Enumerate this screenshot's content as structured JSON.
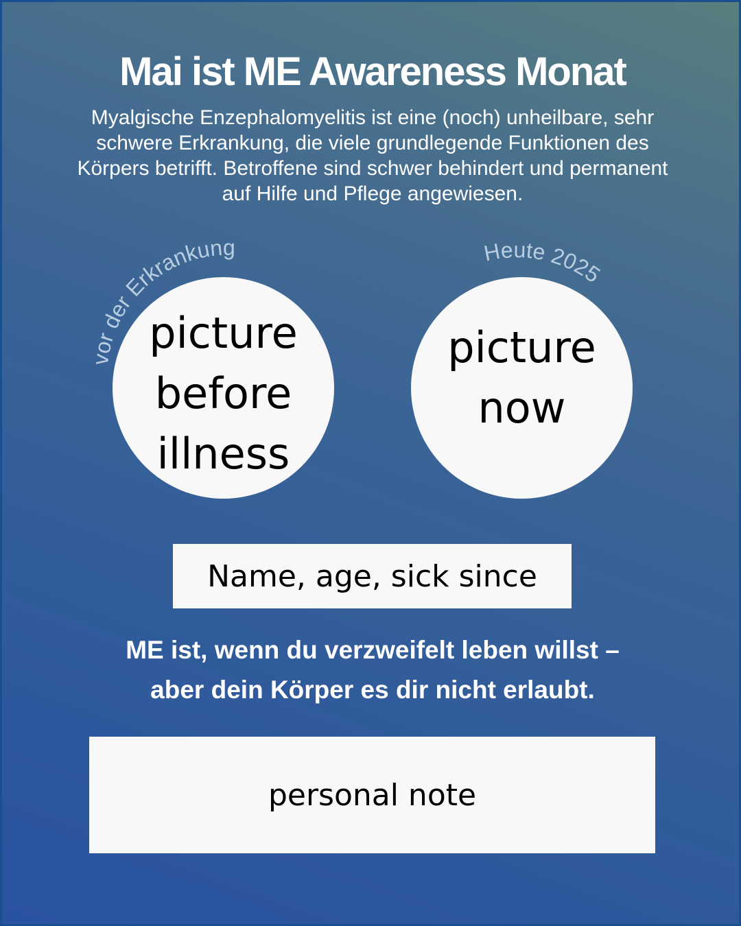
{
  "title": "Mai ist ME Awareness Monat",
  "intro": "Myalgische Enzephalomyelitis ist eine (noch) unheilbare, sehr schwere Erkrankung, die viele grundlegende Funktionen des Körpers betrifft. Betroffene sind schwer behindert und permanent auf Hilfe und Pflege angewiesen.",
  "before": {
    "arc_label": "vor der Erkrankung",
    "placeholder": "picture\nbefore\nillness"
  },
  "now": {
    "arc_label": "Heute 2025",
    "placeholder": "picture\nnow"
  },
  "name_box": "Name, age, sick since",
  "quote": {
    "line1": "ME ist, wenn du verzweifelt leben willst –",
    "line2": "aber dein Körper es dir nicht erlaubt."
  },
  "note_box": "personal note",
  "colors": {
    "text": "#ffffff",
    "arc_label": "#b8cde0",
    "box": "#f8f8f8"
  }
}
